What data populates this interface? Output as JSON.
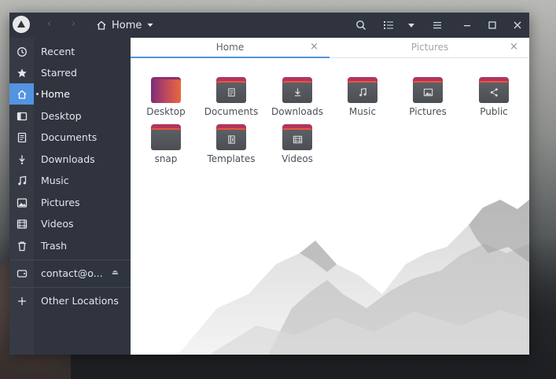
{
  "header": {
    "back_glyph": "‹",
    "forward_glyph": "›",
    "path_label": "Home"
  },
  "sidebar": {
    "items": [
      {
        "label": "Recent",
        "icon": "clock-icon"
      },
      {
        "label": "Starred",
        "icon": "star-icon"
      },
      {
        "label": "Home",
        "icon": "home-icon",
        "active": true
      },
      {
        "label": "Desktop",
        "icon": "desktop-icon"
      },
      {
        "label": "Documents",
        "icon": "document-icon"
      },
      {
        "label": "Downloads",
        "icon": "download-icon"
      },
      {
        "label": "Music",
        "icon": "music-icon"
      },
      {
        "label": "Pictures",
        "icon": "picture-icon"
      },
      {
        "label": "Videos",
        "icon": "video-icon"
      },
      {
        "label": "Trash",
        "icon": "trash-icon"
      }
    ],
    "mount": {
      "label": "contact@o...",
      "eject_glyph": "⏏"
    },
    "other": {
      "label": "Other Locations",
      "icon": "plus-icon"
    }
  },
  "tabs": [
    {
      "label": "Home",
      "active": true
    },
    {
      "label": "Pictures",
      "active": false
    }
  ],
  "tab_close_glyph": "×",
  "files": [
    {
      "label": "Desktop",
      "kind": "desktop"
    },
    {
      "label": "Documents",
      "kind": "documents"
    },
    {
      "label": "Downloads",
      "kind": "downloads"
    },
    {
      "label": "Music",
      "kind": "music"
    },
    {
      "label": "Pictures",
      "kind": "pictures"
    },
    {
      "label": "Public",
      "kind": "public"
    },
    {
      "label": "snap",
      "kind": "plain"
    },
    {
      "label": "Templates",
      "kind": "templates"
    },
    {
      "label": "Videos",
      "kind": "videos"
    }
  ],
  "colors": {
    "accent": "#5294e2",
    "sidebar_bg": "#2f343f",
    "folder_body": "#4b4e53",
    "folder_tab": "#b1365b",
    "folder_stripe": "#e9553f"
  }
}
